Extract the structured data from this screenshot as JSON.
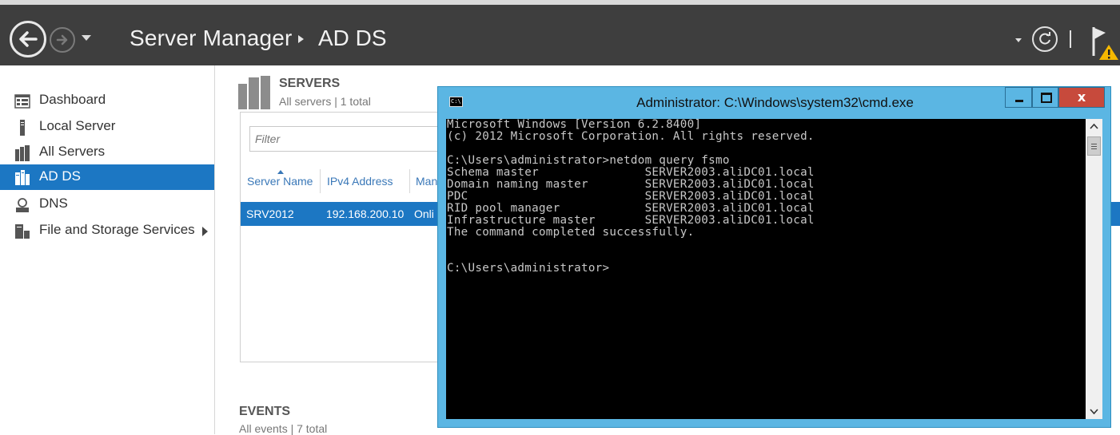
{
  "header": {
    "app_title": "Server Manager",
    "current_page": "AD DS"
  },
  "sidebar": {
    "items": [
      {
        "label": "Dashboard",
        "icon": "dashboard-icon",
        "active": false
      },
      {
        "label": "Local Server",
        "icon": "local-server-icon",
        "active": false
      },
      {
        "label": "All Servers",
        "icon": "all-servers-icon",
        "active": false
      },
      {
        "label": "AD DS",
        "icon": "ad-ds-icon",
        "active": true
      },
      {
        "label": "DNS",
        "icon": "dns-icon",
        "active": false
      },
      {
        "label": "File and Storage Services",
        "icon": "storage-icon",
        "active": false,
        "has_submenu": true
      }
    ]
  },
  "servers": {
    "title": "SERVERS",
    "subtitle": "All servers | 1 total",
    "filter_placeholder": "Filter",
    "columns": [
      "Server Name",
      "IPv4 Address",
      "Man"
    ],
    "rows": [
      {
        "name": "SRV2012",
        "ip": "192.168.200.10",
        "status": "Onli"
      }
    ]
  },
  "events": {
    "title": "EVENTS",
    "subtitle": "All events | 7 total"
  },
  "cmd": {
    "title": "Administrator: C:\\Windows\\system32\\cmd.exe",
    "icon_text": "C:\\",
    "close_label": "x",
    "lines": [
      "Microsoft Windows [Version 6.2.8400]",
      "(c) 2012 Microsoft Corporation. All rights reserved.",
      "",
      "C:\\Users\\administrator>netdom query fsmo",
      "Schema master               SERVER2003.aliDC01.local",
      "Domain naming master        SERVER2003.aliDC01.local",
      "PDC                         SERVER2003.aliDC01.local",
      "RID pool manager            SERVER2003.aliDC01.local",
      "Infrastructure master       SERVER2003.aliDC01.local",
      "The command completed successfully.",
      "",
      "",
      "C:\\Users\\administrator>"
    ]
  },
  "colors": {
    "header_bg": "#3e3e3e",
    "accent": "#1c77c3",
    "cmd_frame": "#5bb6e3",
    "close_button": "#c74a3c"
  }
}
